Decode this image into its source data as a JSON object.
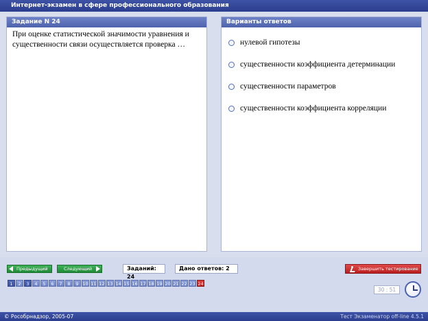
{
  "window": {
    "title": "Интернет-экзамен в сфере профессионального образования"
  },
  "question_panel": {
    "header": "Задание N 24",
    "text": "При оценке статистической значимости уравнения и существенности связи осуществляется проверка …"
  },
  "answers_panel": {
    "header": "Варианты ответов",
    "options": [
      {
        "label": "нулевой гипотезы",
        "selected": false
      },
      {
        "label": "существенности коэффициента детерминации",
        "selected": false
      },
      {
        "label": "существенности параметров",
        "selected": false
      },
      {
        "label": "существенности коэффициента корреляции",
        "selected": false
      }
    ]
  },
  "toolbar": {
    "prev_label": "Предыдущий",
    "next_label": "Следующий",
    "tasks_text": "Заданий: 24",
    "answers_text": "Дано ответов: 2",
    "finish_label": "Завершить тестирование"
  },
  "pagination": {
    "pages": [
      "1",
      "2",
      "3",
      "4",
      "5",
      "6",
      "7",
      "8",
      "9",
      "10",
      "11",
      "12",
      "13",
      "14",
      "15",
      "16",
      "17",
      "18",
      "19",
      "20",
      "21",
      "22",
      "23",
      "24"
    ],
    "answered": [
      "1",
      "3"
    ],
    "current": "24"
  },
  "timer": {
    "value": "30 : 51"
  },
  "footer": {
    "left_text": "© Рособрнадзор, 2005-07",
    "right_text": "Тест Экзаменатор off-line 4.5.1"
  },
  "colors": {
    "title_bar": "#3e53a6",
    "panel_header": "#5e73ba",
    "nav_button": "#2b9e47",
    "finish_button": "#cc2f2f",
    "current_page": "#cf2e2e"
  }
}
